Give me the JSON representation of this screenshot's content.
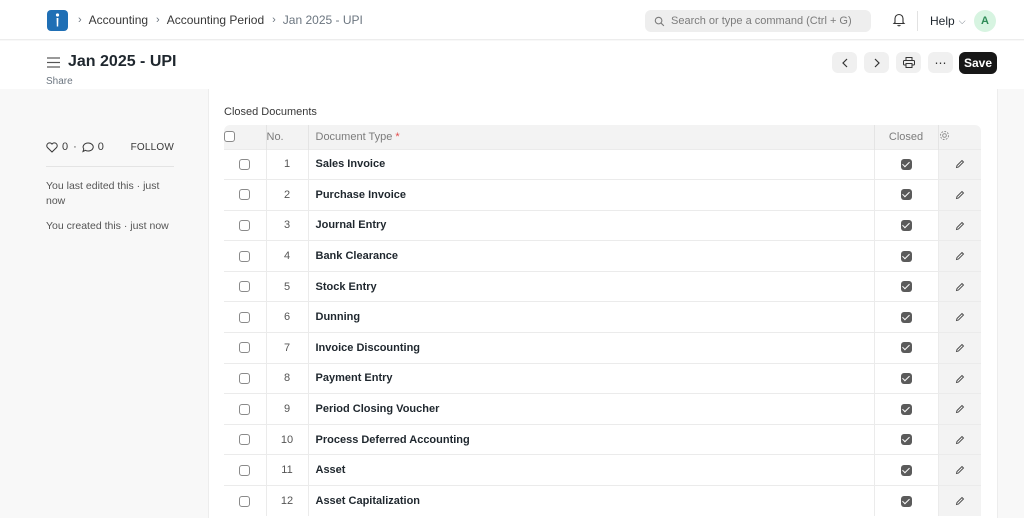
{
  "navbar": {
    "breadcrumbs": [
      "Accounting",
      "Accounting Period",
      "Jan 2025 - UPI"
    ],
    "search_placeholder": "Search or type a command (Ctrl + G)",
    "help_label": "Help",
    "avatar_initial": "A"
  },
  "header": {
    "title": "Jan 2025 - UPI",
    "save_label": "Save"
  },
  "sidebar": {
    "share_label": "Share",
    "likes_count": "0",
    "comments_count": "0",
    "follow_label": "FOLLOW",
    "last_edited": "You last edited this · just now",
    "created": "You created this · just now"
  },
  "form": {
    "section_label": "Closed Documents",
    "columns": {
      "no": "No.",
      "document_type": "Document Type",
      "required_mark": "*",
      "closed": "Closed"
    },
    "rows": [
      {
        "no": "1",
        "document_type": "Sales Invoice",
        "closed": true
      },
      {
        "no": "2",
        "document_type": "Purchase Invoice",
        "closed": true
      },
      {
        "no": "3",
        "document_type": "Journal Entry",
        "closed": true
      },
      {
        "no": "4",
        "document_type": "Bank Clearance",
        "closed": true
      },
      {
        "no": "5",
        "document_type": "Stock Entry",
        "closed": true
      },
      {
        "no": "6",
        "document_type": "Dunning",
        "closed": true
      },
      {
        "no": "7",
        "document_type": "Invoice Discounting",
        "closed": true
      },
      {
        "no": "8",
        "document_type": "Payment Entry",
        "closed": true
      },
      {
        "no": "9",
        "document_type": "Period Closing Voucher",
        "closed": true
      },
      {
        "no": "10",
        "document_type": "Process Deferred Accounting",
        "closed": true
      },
      {
        "no": "11",
        "document_type": "Asset",
        "closed": true
      },
      {
        "no": "12",
        "document_type": "Asset Capitalization",
        "closed": true
      }
    ]
  },
  "icons": {
    "logo": "app-logo-icon",
    "search": "search-icon",
    "bell": "bell-icon",
    "menu": "hamburger-icon",
    "prev": "chevron-left-icon",
    "next": "chevron-right-icon",
    "print": "printer-icon",
    "more": "ellipsis-icon",
    "heart": "heart-icon",
    "comment": "comment-icon",
    "settings": "settings-icon",
    "edit": "edit-icon"
  },
  "colors": {
    "brand": "#1f6fb5",
    "primary_button": "#171717",
    "avatar_bg": "#d7f4e1",
    "required": "#e24c4c"
  }
}
